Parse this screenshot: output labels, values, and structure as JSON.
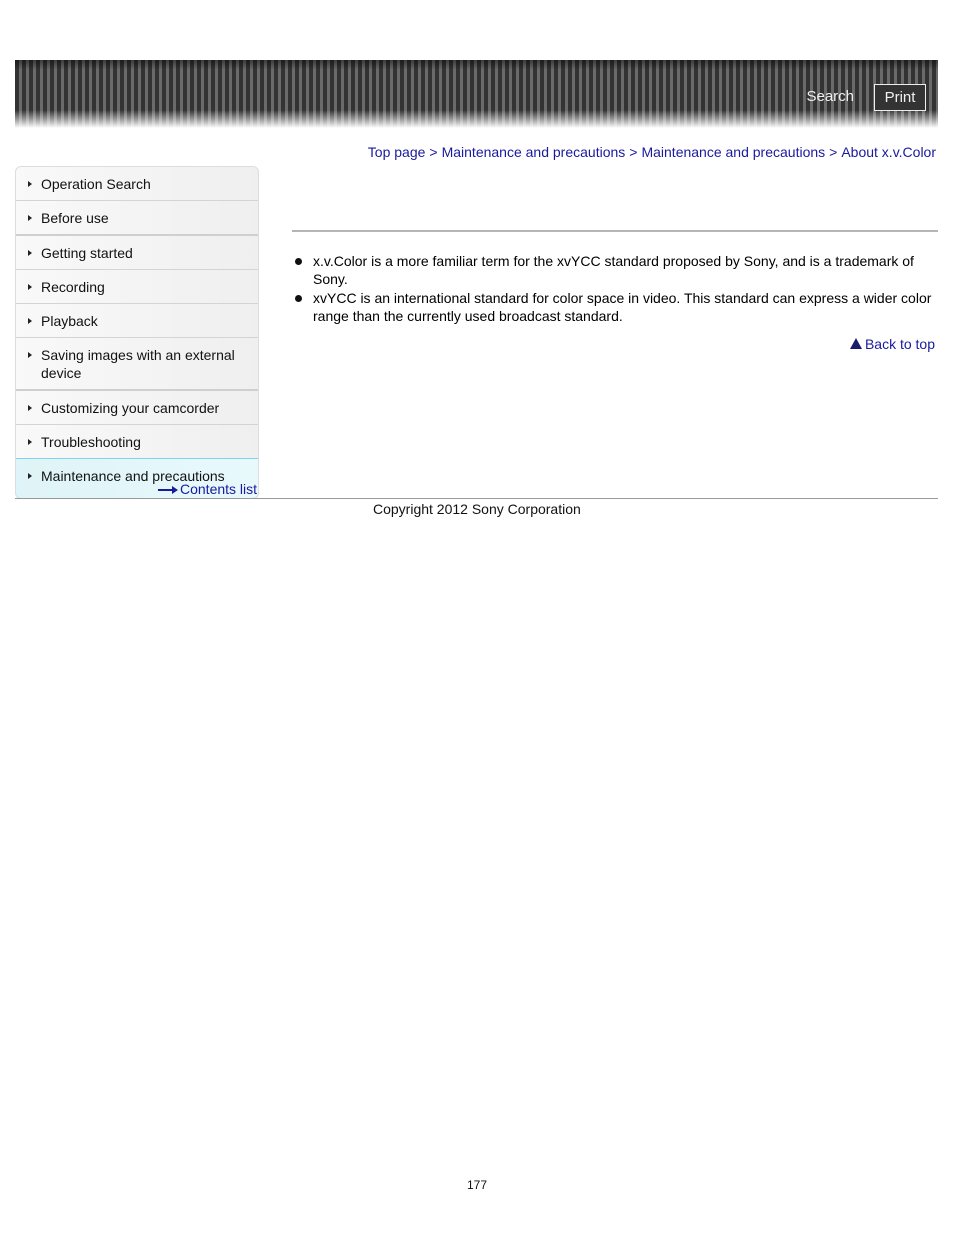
{
  "header": {
    "search_label": "Search",
    "print_label": "Print"
  },
  "breadcrumb": [
    {
      "label": "Top page"
    },
    {
      "label": "Maintenance and precautions"
    },
    {
      "label": "Maintenance and precautions"
    },
    {
      "label": "About x.v.Color"
    }
  ],
  "breadcrumb_separator": ">",
  "sidebar": {
    "items": [
      {
        "label": "Operation Search"
      },
      {
        "label": "Before use"
      },
      {
        "label": "Getting started"
      },
      {
        "label": "Recording"
      },
      {
        "label": "Playback"
      },
      {
        "label": "Saving images with an external device"
      },
      {
        "label": "Customizing your camcorder"
      },
      {
        "label": "Troubleshooting"
      },
      {
        "label": "Maintenance and precautions",
        "active": true
      }
    ],
    "contents_link": "Contents list"
  },
  "content": {
    "bullets": [
      "x.v.Color is a more familiar term for the xvYCC standard proposed by Sony, and is a trademark of Sony.",
      "xvYCC is an international standard for color space in video. This standard can express a wider color range than the currently used broadcast standard."
    ],
    "back_to_top": "Back to top"
  },
  "footer": {
    "copyright": "Copyright 2012 Sony Corporation",
    "page_number": "177"
  },
  "colors": {
    "link": "#1a1a9e",
    "active_nav_border": "#7fd3ea",
    "active_nav_bg": "#dff4f8"
  }
}
